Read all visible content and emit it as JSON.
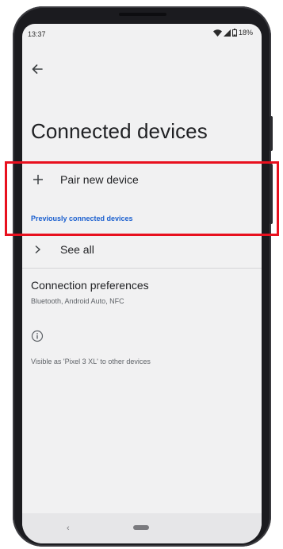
{
  "status_bar": {
    "time": "13:37",
    "battery": "18%"
  },
  "header": {
    "title": "Connected devices",
    "back_icon": "arrow-left-icon"
  },
  "pair_new_device": {
    "label": "Pair new device",
    "icon": "plus-icon"
  },
  "previously_connected": {
    "header": "Previously connected devices",
    "see_all_label": "See all",
    "see_all_icon": "chevron-right-icon"
  },
  "connection_preferences": {
    "title": "Connection preferences",
    "subtitle": "Bluetooth, Android Auto, NFC"
  },
  "footer": {
    "info_icon": "info-icon",
    "visibility_text": "Visible as 'Pixel 3 XL' to other devices"
  },
  "colors": {
    "accent": "#1a5fcf",
    "highlight": "#e8101e",
    "screen_background": "#f1f1f2",
    "phone_body": "#1b1b1f"
  }
}
